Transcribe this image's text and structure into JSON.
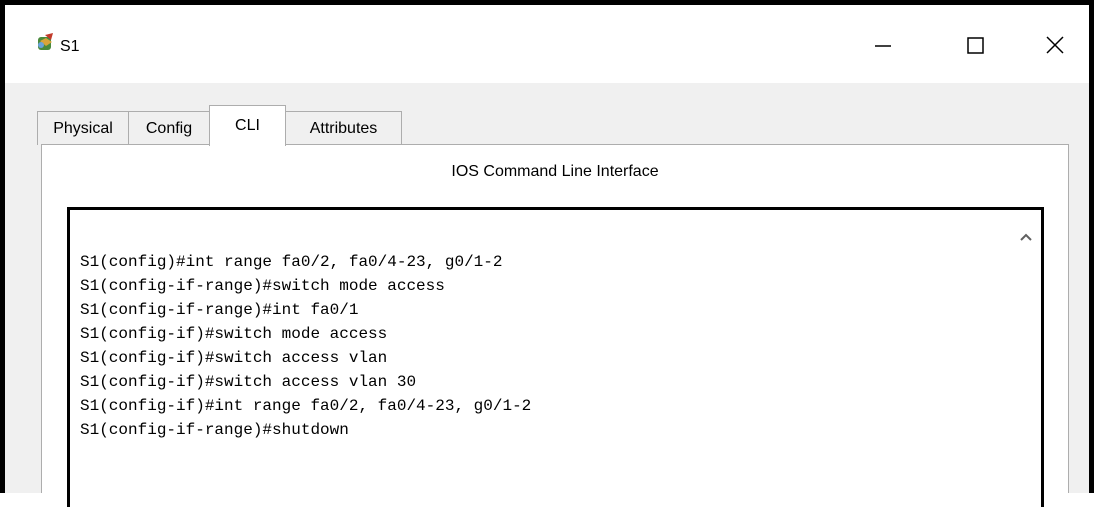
{
  "window": {
    "title": "S1",
    "app_icon": "packet-tracer-switch-icon",
    "controls": [
      "minimize-icon",
      "maximize-icon",
      "close-icon"
    ]
  },
  "tabs": [
    {
      "label": "Physical",
      "active": false
    },
    {
      "label": "Config",
      "active": false
    },
    {
      "label": "CLI",
      "active": true
    },
    {
      "label": "Attributes",
      "active": false
    }
  ],
  "panel": {
    "title": "IOS Command Line Interface"
  },
  "cli": {
    "lines": [
      "S1(config)#int range fa0/2, fa0/4-23, g0/1-2",
      "S1(config-if-range)#switch mode access",
      "S1(config-if-range)#int fa0/1",
      "S1(config-if)#switch mode access",
      "S1(config-if)#switch access vlan",
      "S1(config-if)#switch access vlan 30",
      "S1(config-if)#int range fa0/2, fa0/4-23, g0/1-2",
      "S1(config-if-range)#shutdown"
    ],
    "scroll_icon": "scroll-up-arrow-icon"
  }
}
